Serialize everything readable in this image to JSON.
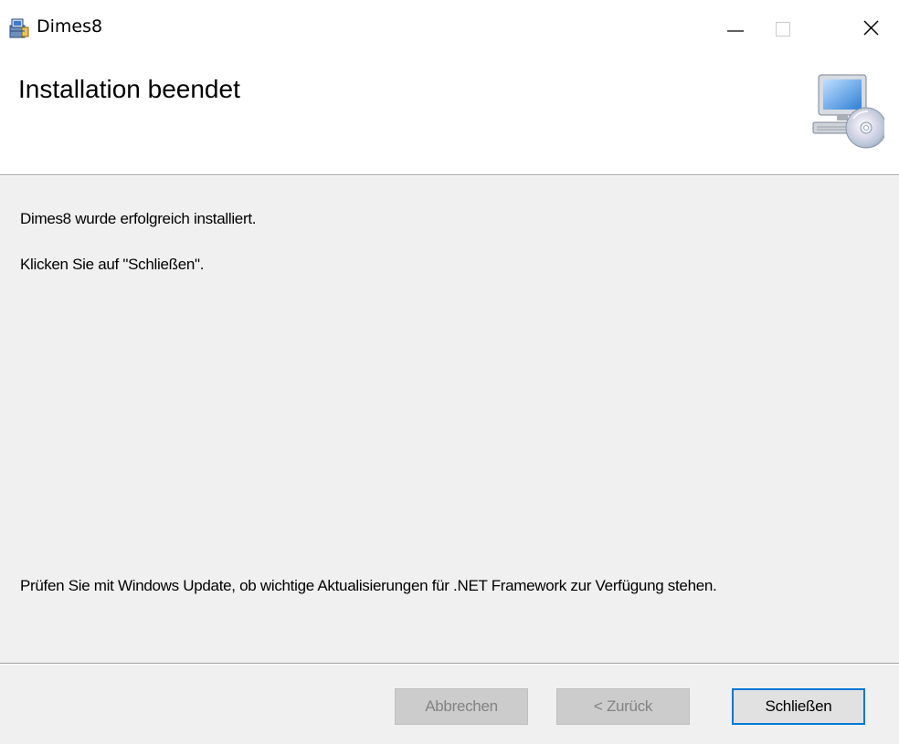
{
  "window": {
    "title": "Dimes8",
    "icon": "installer-package-icon",
    "controls": [
      "minimize-icon",
      "maximize-icon",
      "close-icon"
    ]
  },
  "header": {
    "title": "Installation beendet",
    "icon": "computer-cd-setup-icon"
  },
  "content": {
    "message_success": "Dimes8 wurde erfolgreich installiert.",
    "message_instruction": "Klicken Sie auf \"Schließen\".",
    "message_update": "Prüfen Sie mit Windows Update, ob wichtige Aktualisierungen für .NET Framework zur Verfügung stehen."
  },
  "footer": {
    "cancel_label": "Abbrechen",
    "back_label": "< Zurück",
    "close_label": "Schließen"
  },
  "colors": {
    "content_bg": "#f0f0f0",
    "focus_border": "#0078d7",
    "disabled_text": "#838383"
  }
}
